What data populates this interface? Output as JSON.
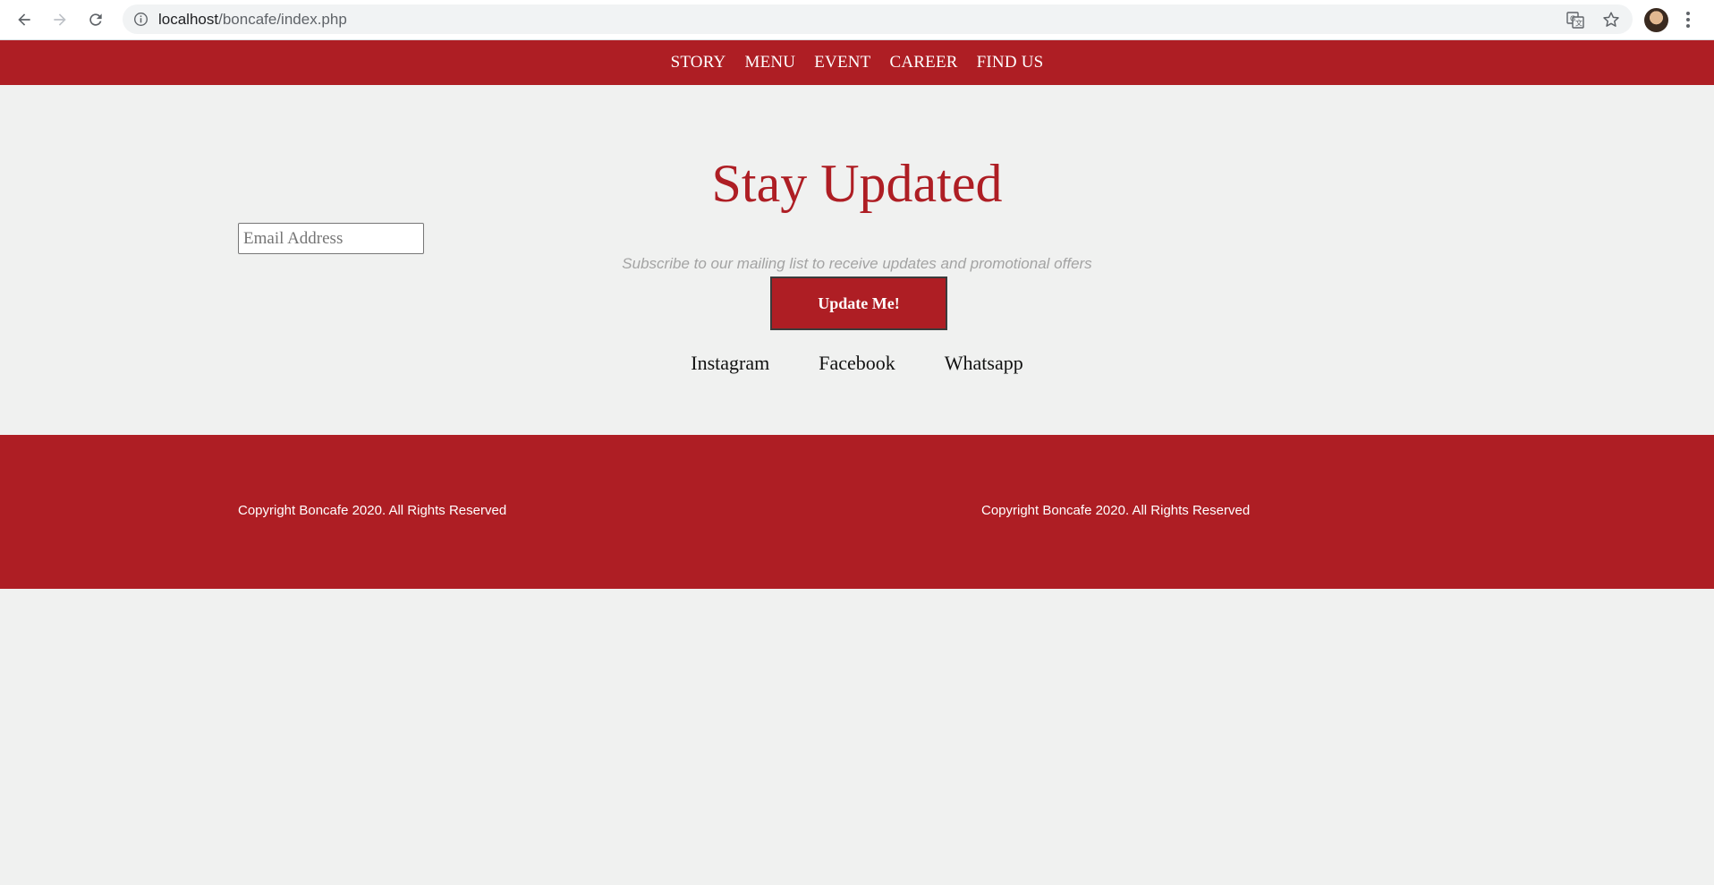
{
  "browser": {
    "url_host": "localhost",
    "url_path": "/boncafe/index.php",
    "icons": [
      "back-arrow-icon",
      "forward-arrow-icon",
      "reload-icon",
      "info-icon",
      "translate-icon",
      "star-icon",
      "avatar",
      "menu-dots-icon"
    ]
  },
  "navbar": {
    "items": [
      "STORY",
      "MENU",
      "EVENT",
      "CAREER",
      "FIND US"
    ]
  },
  "subscribe": {
    "title": "Stay Updated",
    "email_placeholder": "Email Address",
    "email_value": "",
    "subtitle": "Subscribe to our mailing list to receive updates and promotional offers",
    "button_label": "Update Me!"
  },
  "social": {
    "links": [
      "Instagram",
      "Facebook",
      "Whatsapp"
    ]
  },
  "footer": {
    "copyright_left": "Copyright Boncafe 2020. All Rights Reserved",
    "copyright_right": "Copyright Boncafe 2020. All Rights Reserved"
  },
  "colors": {
    "brand_red": "#ae1e24",
    "page_background": "#f0f1f0",
    "subtitle_gray": "#a3a3a3"
  }
}
